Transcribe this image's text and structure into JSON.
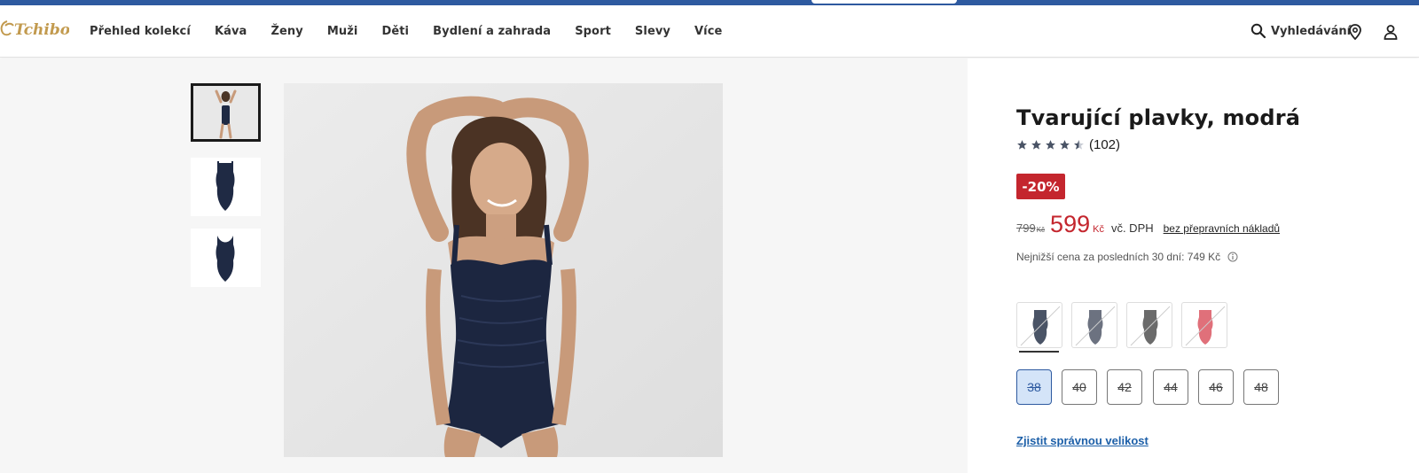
{
  "header": {
    "logo_text": "Tchibo",
    "nav": [
      "Přehled kolekcí",
      "Káva",
      "Ženy",
      "Muži",
      "Děti",
      "Bydlení a zahrada",
      "Sport",
      "Slevy",
      "Více"
    ],
    "search_label": "Vyhledávání",
    "icons": [
      "search-icon",
      "location-pin-icon",
      "user-icon"
    ]
  },
  "gallery": {
    "thumbnails": [
      "model-front",
      "swimsuit-front",
      "swimsuit-back"
    ],
    "active_thumbnail": 0
  },
  "product": {
    "title": "Tvarující plavky, modrá",
    "rating": 4.5,
    "review_count": "(102)",
    "discount_badge": "-20%",
    "old_price": "799",
    "old_currency": "Kč",
    "price": "599",
    "currency": "Kč",
    "vat_note": "vč. DPH",
    "shipping_link": "bez přepravních nákladů",
    "lowest_price_note": "Nejnižší cena za posledních 30 dní: 749 Kč"
  },
  "swatches": [
    {
      "name": "navy",
      "color": "#4a5466"
    },
    {
      "name": "grey-blue",
      "color": "#6c7280"
    },
    {
      "name": "dark-grey",
      "color": "#6b6b6b"
    },
    {
      "name": "coral",
      "color": "#e0707a"
    }
  ],
  "sizes": [
    "38",
    "40",
    "42",
    "44",
    "46",
    "48"
  ],
  "selected_size": "38",
  "size_guide_link": "Zjistit správnou velikost",
  "colors": {
    "accent_blue": "#2e5aa0",
    "sale_red": "#c4262e",
    "link_blue": "#1c5fa8",
    "logo_gold": "#c29a4e"
  }
}
